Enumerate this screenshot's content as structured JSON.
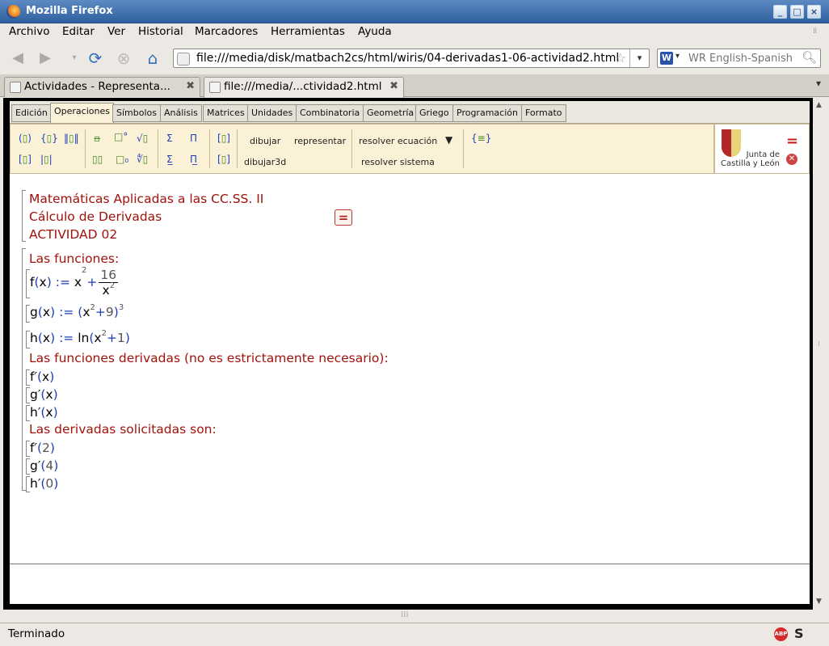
{
  "window": {
    "title": "Mozilla Firefox",
    "min": "_",
    "max": "□",
    "close": "×"
  },
  "menubar": [
    "Archivo",
    "Editar",
    "Ver",
    "Historial",
    "Marcadores",
    "Herramientas",
    "Ayuda"
  ],
  "url": "file:///media/disk/matbach2cs/html/wiris/04-derivadas1-06-actividad2.html",
  "search": {
    "engine": "W",
    "placeholder": "WR English-Spanish"
  },
  "tabs": [
    {
      "label": "Actividades - Representa..."
    },
    {
      "label": "file:///media/...ctividad2.html"
    }
  ],
  "wiris": {
    "tabs": [
      "Edición",
      "Operaciones",
      "Símbolos",
      "Análisis",
      "Matrices",
      "Unidades",
      "Combinatoria",
      "Geometría",
      "Griego",
      "Programación",
      "Formato"
    ],
    "buttons": {
      "dibujar": "dibujar",
      "representar": "representar",
      "dibujar3d": "dibujar3d",
      "resolver_ecuacion": "resolver ecuación",
      "resolver_sistema": "resolver sistema"
    },
    "logo_text": "Junta de Castilla y León"
  },
  "doc": {
    "header": [
      "Matemáticas Aplicadas a las CC.SS. II",
      "Cálculo de Derivadas",
      "ACTIVIDAD 02"
    ],
    "las_funciones": "Las funciones:",
    "funciones_derivadas": "Las funciones derivadas (no es estrictamente necesario):",
    "derivadas_solicitadas": "Las derivadas solicitadas son:"
  },
  "status": "Terminado"
}
